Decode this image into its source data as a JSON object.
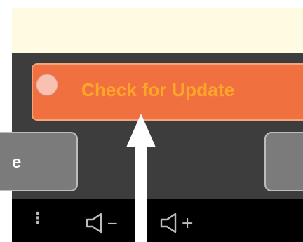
{
  "main": {
    "update_button_label": "Check for Update",
    "left_button_label": "e"
  },
  "nav_bar": {
    "menu_glyph": "⋮",
    "volume_down_glyph": "−",
    "volume_up_glyph": "+"
  },
  "icons": {
    "menu": "menu-dots-icon",
    "volume_down": "volume-down-icon",
    "volume_up": "volume-up-icon",
    "touch_indicator": "touch-indicator",
    "annotation_arrow": "up-arrow-icon"
  },
  "colors": {
    "notice_bar": "#fffbe3",
    "app_background": "#3d3d3d",
    "update_button": "#f07040",
    "update_label": "#ffa62a",
    "grey_button": "#7b7b7b",
    "nav_bar": "#000000"
  }
}
